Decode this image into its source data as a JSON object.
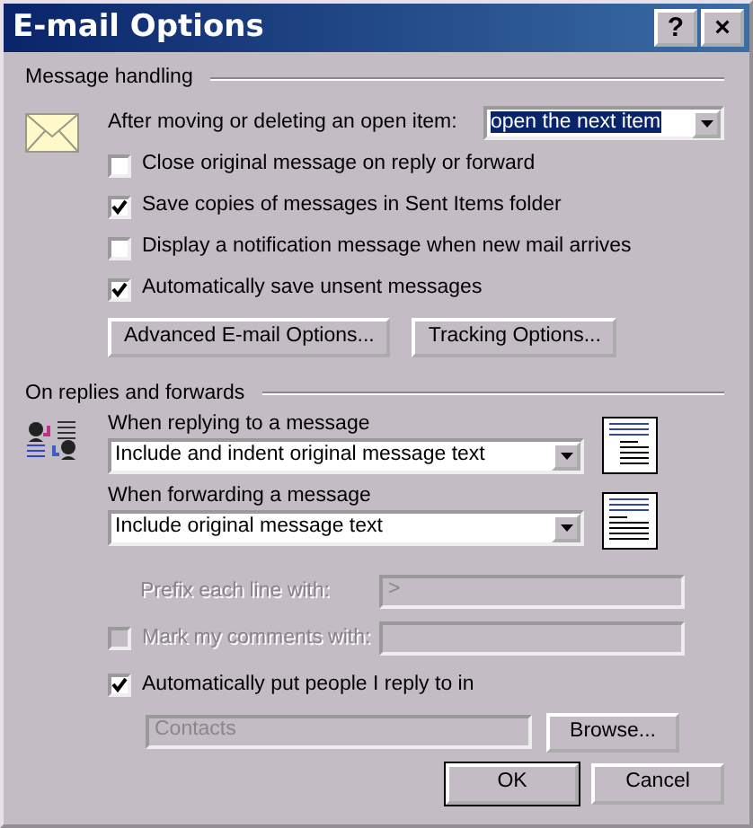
{
  "window": {
    "title": "E-mail Options",
    "title_buttons": [
      "?",
      "×"
    ]
  },
  "message_handling": {
    "heading": "Message handling",
    "open_item": {
      "label": "After moving or deleting an open item:",
      "value": "open the next item",
      "focused": true
    },
    "checkboxes": [
      {
        "label": "Close original message on reply or forward",
        "checked": false
      },
      {
        "label": "Save copies of messages in Sent Items folder",
        "checked": true
      },
      {
        "label": "Display a notification message when new mail arrives",
        "checked": false
      },
      {
        "label": "Automatically save unsent messages",
        "checked": true
      }
    ],
    "buttons": [
      "Advanced E-mail Options...",
      "Tracking Options..."
    ]
  },
  "replies": {
    "heading": "On replies and forwards",
    "selects": [
      {
        "label": "When replying to a message",
        "value": "Include and indent original message text"
      },
      {
        "label": "When forwarding a message",
        "value": "Include original message text"
      }
    ],
    "prefix": {
      "label": "Prefix each line with:",
      "value": ">",
      "disabled": true
    },
    "mark": {
      "label": "Mark my comments with:",
      "checked": false,
      "disabled": true
    },
    "auto": {
      "label": "Automatically put people I reply to in",
      "checked": true
    },
    "folder": {
      "value": "Contacts",
      "disabled": true
    },
    "browse": "Browse..."
  },
  "footer": [
    {
      "label": "OK",
      "default": true
    },
    {
      "label": "Cancel",
      "default": false
    }
  ]
}
